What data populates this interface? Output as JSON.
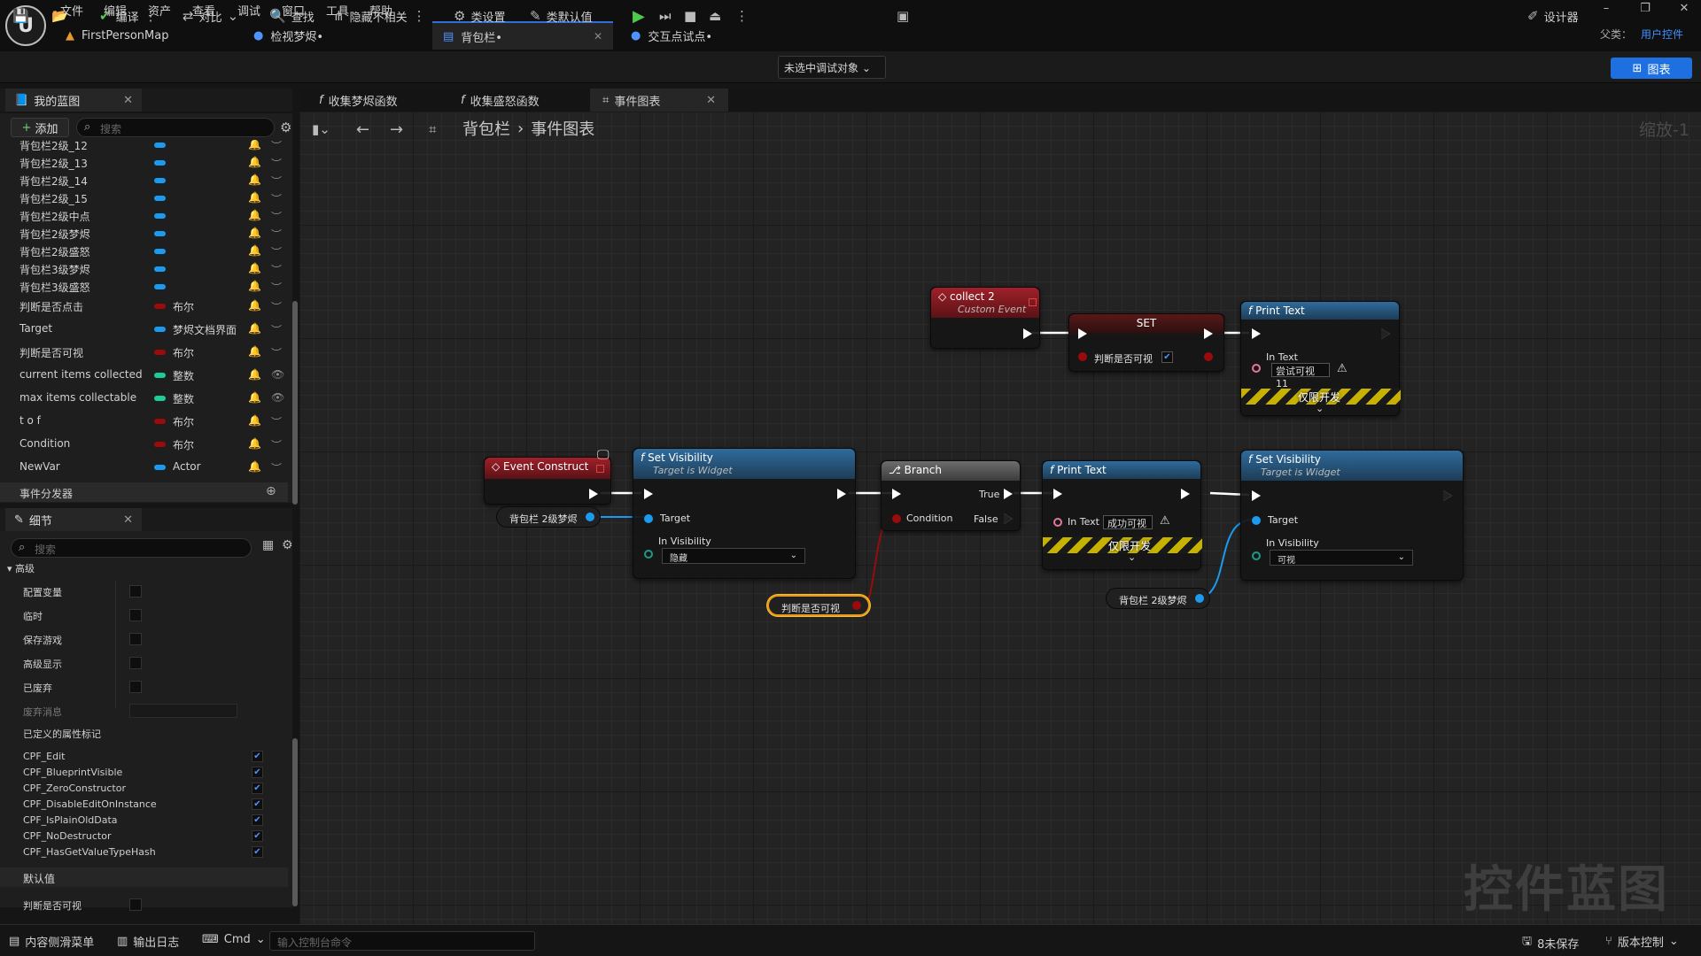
{
  "menu": [
    "文件",
    "编辑",
    "资产",
    "查看",
    "调试",
    "窗口",
    "工具",
    "帮助"
  ],
  "tabs": [
    {
      "label": "FirstPersonMap"
    },
    {
      "label": "检视梦烬•"
    },
    {
      "label": "背包栏•"
    },
    {
      "label": "交互点试点•"
    }
  ],
  "parent": {
    "label": "父类：",
    "value": "用户控件"
  },
  "toolbar": {
    "compile": "编译",
    "diff": "对比",
    "find": "查找",
    "hide": "隐藏不相关",
    "class_settings": "类设置",
    "class_defaults": "类默认值",
    "debug_target": "未选中调试对象",
    "designer": "设计器",
    "graph": "图表"
  },
  "my_blueprint": {
    "title": "我的蓝图",
    "add": "添加",
    "search_placeholder": "搜索"
  },
  "variables": [
    {
      "name": "背包栏2级_12",
      "color": "#1b9bf0",
      "type": ""
    },
    {
      "name": "背包栏2级_13",
      "color": "#1b9bf0",
      "type": ""
    },
    {
      "name": "背包栏2级_14",
      "color": "#1b9bf0",
      "type": ""
    },
    {
      "name": "背包栏2级_15",
      "color": "#1b9bf0",
      "type": ""
    },
    {
      "name": "背包栏2级中点",
      "color": "#1b9bf0",
      "type": ""
    },
    {
      "name": "背包栏2级梦烬",
      "color": "#1b9bf0",
      "type": ""
    },
    {
      "name": "背包栏2级盛怒",
      "color": "#1b9bf0",
      "type": ""
    },
    {
      "name": "背包栏3级梦烬",
      "color": "#1b9bf0",
      "type": ""
    },
    {
      "name": "背包栏3级盛怒",
      "color": "#1b9bf0",
      "type": ""
    },
    {
      "name": "判断是否点击",
      "color": "#9b0b0b",
      "type": "布尔"
    },
    {
      "name": "Target",
      "color": "#1b9bf0",
      "type": "梦烬文档界面"
    },
    {
      "name": "判断是否可视",
      "color": "#9b0b0b",
      "type": "布尔"
    },
    {
      "name": "current items collected",
      "color": "#1ccd9a",
      "type": "整数"
    },
    {
      "name": "max items collectable",
      "color": "#1ccd9a",
      "type": "整数"
    },
    {
      "name": "t o f",
      "color": "#9b0b0b",
      "type": "布尔"
    },
    {
      "name": "Condition",
      "color": "#9b0b0b",
      "type": "布尔"
    },
    {
      "name": "NewVar",
      "color": "#1b9bf0",
      "type": "Actor"
    }
  ],
  "dispatchers": "事件分发器",
  "details": {
    "title": "细节",
    "search_placeholder": "搜索",
    "section_advanced": "高级",
    "rows": [
      "配置变量",
      "临时",
      "保存游戏",
      "高级显示",
      "已废弃",
      "废弃消息"
    ],
    "flags_title": "已定义的属性标记",
    "flags": [
      "CPF_Edit",
      "CPF_BlueprintVisible",
      "CPF_ZeroConstructor",
      "CPF_DisableEditOnInstance",
      "CPF_IsPlainOldData",
      "CPF_NoDestructor",
      "CPF_HasGetValueTypeHash"
    ],
    "section_default": "默认值",
    "default_row": "判断是否可视"
  },
  "graph_tabs": [
    {
      "label": "收集梦烬函数"
    },
    {
      "label": "收集盛怒函数"
    },
    {
      "label": "事件图表"
    }
  ],
  "breadcrumb": {
    "root": "背包栏",
    "leaf": "事件图表"
  },
  "zoom": "缩放-1",
  "watermark": "控件蓝图",
  "nodes": {
    "collect": {
      "title": "collect 2",
      "sub": "Custom Event"
    },
    "set": {
      "title": "SET",
      "pin": "判断是否可视"
    },
    "print1": {
      "title": "Print Text",
      "in_text": "In Text",
      "value": "尝试可视11",
      "dev": "仅限开发"
    },
    "event_construct": {
      "title": "Event Construct"
    },
    "setvis1": {
      "title": "Set Visibility",
      "sub": "Target is Widget",
      "target": "Target",
      "in_vis": "In Visibility",
      "value": "隐藏"
    },
    "branch": {
      "title": "Branch",
      "true": "True",
      "false": "False",
      "condition": "Condition"
    },
    "print2": {
      "title": "Print Text",
      "in_text": "In Text",
      "value": "成功可视",
      "dev": "仅限开发"
    },
    "setvis2": {
      "title": "Set Visibility",
      "sub": "Target is Widget",
      "target": "Target",
      "in_vis": "In Visibility",
      "value": "可视"
    },
    "var_bag1": "背包栏 2级梦烬",
    "var_bag2": "背包栏 2级梦烬",
    "var_visible": "判断是否可视"
  },
  "status": {
    "drawer": "内容侧滑菜单",
    "log": "输出日志",
    "cmd": "Cmd",
    "console_placeholder": "输入控制台命令",
    "unsaved": "8未保存",
    "source": "版本控制"
  }
}
